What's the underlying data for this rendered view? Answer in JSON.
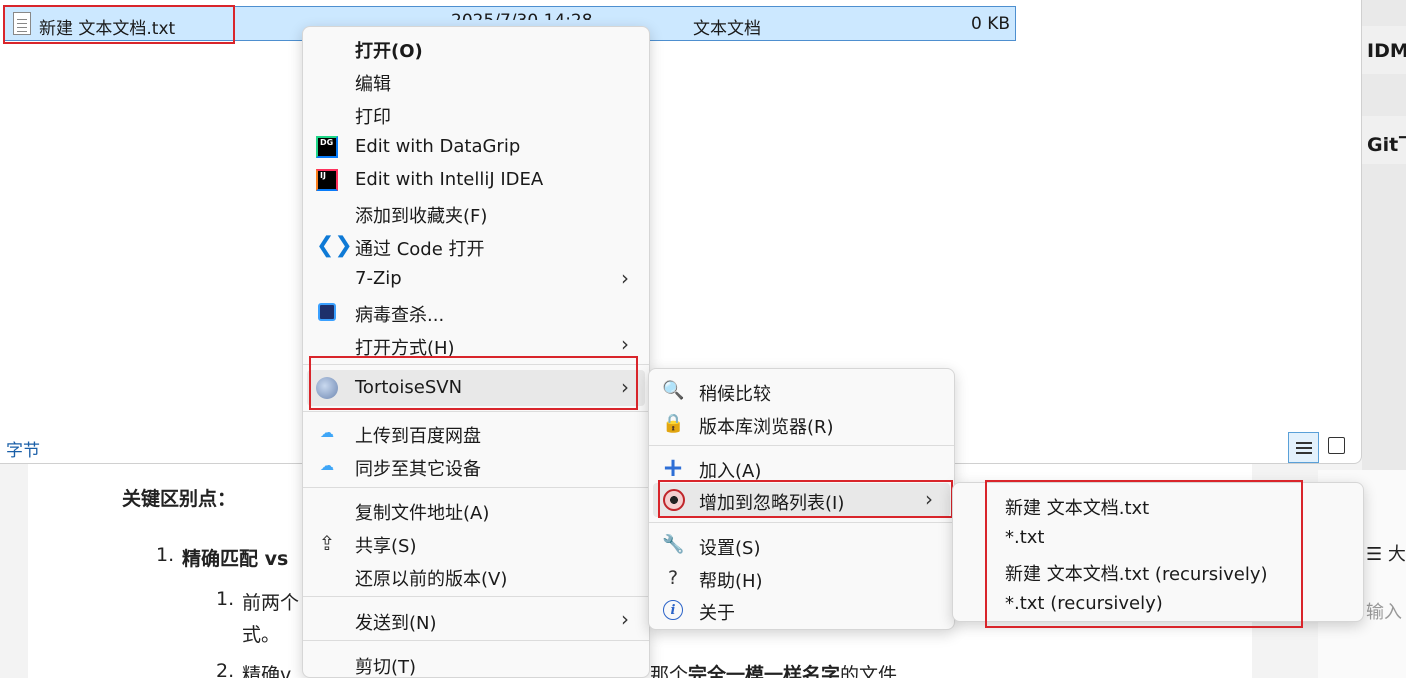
{
  "explorer": {
    "file": {
      "name": "新建 文本文档.txt",
      "date": "2025/7/30 14:28",
      "type": "文本文档",
      "size": "0 KB"
    },
    "status_text": "字节"
  },
  "right_strip": {
    "btn1": "IDM",
    "btn2": "Git下",
    "lower_icon": "☰ 大",
    "lower_input": "输入"
  },
  "document": {
    "heading": "关键区别点：",
    "item1_num": "1.",
    "item1_text": "精确匹配 vs",
    "sub1_num": "1.",
    "sub1_text": "前两个",
    "sub1_cont": "式。",
    "sub2_num": "2.",
    "sub2_text": "精确v",
    "sub2_mid": "那个",
    "sub2_bold": "完全一模一样名字",
    "sub2_end": "的文件"
  },
  "context_menu": {
    "items": [
      {
        "label": "打开(O)",
        "bold": true
      },
      {
        "label": "编辑"
      },
      {
        "label": "打印"
      },
      {
        "label": "Edit with DataGrip",
        "icon": "datagrip-icon"
      },
      {
        "label": "Edit with IntelliJ IDEA",
        "icon": "intellij-icon"
      },
      {
        "label": "添加到收藏夹(F)"
      },
      {
        "label": "通过 Code 打开",
        "icon": "vscode-icon"
      },
      {
        "label": "7-Zip",
        "submenu": true
      },
      {
        "label": "病毒查杀...",
        "icon": "antivirus-icon"
      },
      {
        "label": "打开方式(H)",
        "submenu": true
      },
      {
        "label": "TortoiseSVN",
        "submenu": true,
        "icon": "tortoisesvn-icon"
      },
      {
        "label": "上传到百度网盘",
        "icon": "baidu-cloud-icon"
      },
      {
        "label": "同步至其它设备",
        "icon": "baidu-sync-icon"
      },
      {
        "label": "复制文件地址(A)"
      },
      {
        "label": "共享(S)",
        "icon": "share-icon"
      },
      {
        "label": "还原以前的版本(V)"
      },
      {
        "label": "发送到(N)",
        "submenu": true
      },
      {
        "label": "剪切(T)"
      }
    ]
  },
  "svn_menu": {
    "items": [
      {
        "label": "稍候比较",
        "icon": "magnifier-icon"
      },
      {
        "label": "版本库浏览器(R)",
        "icon": "repo-browser-icon"
      },
      {
        "label": "加入(A)",
        "icon": "add-icon"
      },
      {
        "label": "增加到忽略列表(I)",
        "icon": "ignore-icon",
        "submenu": true
      },
      {
        "label": "设置(S)",
        "icon": "wrench-icon"
      },
      {
        "label": "帮助(H)",
        "icon": "help-icon"
      },
      {
        "label": "关于",
        "icon": "info-icon"
      }
    ]
  },
  "ignore_menu": {
    "items": [
      {
        "label": "新建 文本文档.txt"
      },
      {
        "label": "*.txt"
      },
      {
        "label": "新建 文本文档.txt (recursively)"
      },
      {
        "label": "*.txt (recursively)"
      }
    ]
  },
  "colors": {
    "highlight_box": "#d9252b",
    "selection": "#cce8ff"
  }
}
